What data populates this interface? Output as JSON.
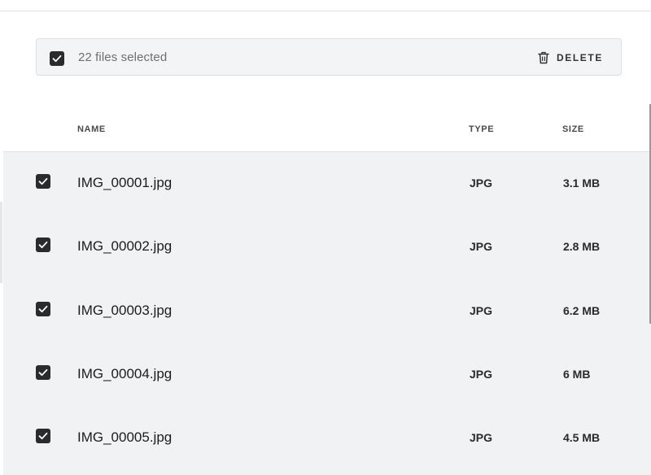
{
  "selection_bar": {
    "selected_text": "22 files selected",
    "delete_label": "DELETE"
  },
  "table": {
    "columns": {
      "name": "NAME",
      "type": "TYPE",
      "size": "SIZE"
    },
    "rows": [
      {
        "name": "IMG_00001.jpg",
        "type": "JPG",
        "size": "3.1 MB",
        "checked": true
      },
      {
        "name": "IMG_00002.jpg",
        "type": "JPG",
        "size": "2.8 MB",
        "checked": true
      },
      {
        "name": "IMG_00003.jpg",
        "type": "JPG",
        "size": "6.2 MB",
        "checked": true
      },
      {
        "name": "IMG_00004.jpg",
        "type": "JPG",
        "size": "6 MB",
        "checked": true
      },
      {
        "name": "IMG_00005.jpg",
        "type": "JPG",
        "size": "4.5 MB",
        "checked": true
      }
    ]
  },
  "icons": {
    "checkbox": "check-icon",
    "delete": "trash-icon"
  },
  "colors": {
    "checkbox_fill": "#2b2b2b",
    "selection_bar_bg": "#f3f4f5",
    "row_bg": "#f1f2f3"
  }
}
